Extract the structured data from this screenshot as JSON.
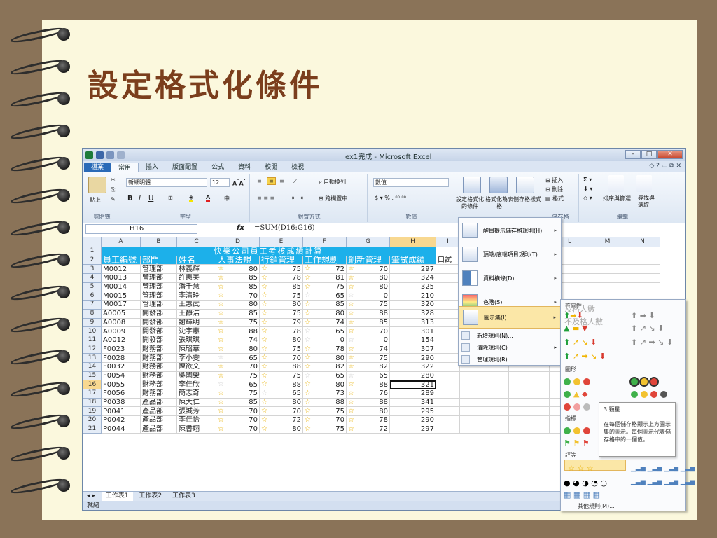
{
  "slide": {
    "title": "設定格式化條件"
  },
  "excel": {
    "window_title": "ex1完成 - Microsoft Excel",
    "tabs": [
      "檔案",
      "常用",
      "插入",
      "版面配置",
      "公式",
      "資料",
      "校閱",
      "檢視"
    ],
    "ribbon": {
      "clipboard": {
        "paste": "貼上",
        "label": "剪貼簿"
      },
      "font": {
        "name": "新細明體",
        "size": "12",
        "label": "字型"
      },
      "alignment": {
        "wrap": "自動換列",
        "merge": "跨欄置中",
        "label": "對齊方式"
      },
      "number": {
        "format": "數值",
        "label": "數值"
      },
      "styles": {
        "cond_format": "設定格式化的條件",
        "table_format": "格式化為表格",
        "cell_styles": "儲存格樣式"
      },
      "cells": {
        "insert": "插入",
        "delete": "刪除",
        "format": "格式",
        "label": "儲存格"
      },
      "editing": {
        "sort": "排序與篩選",
        "find": "尋找與選取",
        "label": "編輯"
      }
    },
    "namebox": "H16",
    "formula": "=SUM(D16:G16)",
    "columns": [
      "A",
      "B",
      "C",
      "D",
      "E",
      "F",
      "G",
      "H",
      "I",
      "J",
      "K",
      "L",
      "M",
      "N"
    ],
    "banner": "快樂公司員工考核成績計算",
    "headers": [
      "員工編號",
      "部門",
      "姓名",
      "人事法規",
      "行銷管理",
      "工作規劃",
      "創新管理",
      "筆試成績",
      "口試"
    ],
    "rows": [
      {
        "r": "3",
        "id": "M0012",
        "dept": "管理部",
        "name": "林義輝",
        "d": "80",
        "e": "75",
        "f": "72",
        "g": "70",
        "h": "297"
      },
      {
        "r": "4",
        "id": "M0013",
        "dept": "管理部",
        "name": "許惠美",
        "d": "85",
        "e": "78",
        "f": "81",
        "g": "80",
        "h": "324"
      },
      {
        "r": "5",
        "id": "M0014",
        "dept": "管理部",
        "name": "潘千慧",
        "d": "85",
        "e": "85",
        "f": "75",
        "g": "80",
        "h": "325"
      },
      {
        "r": "6",
        "id": "M0015",
        "dept": "管理部",
        "name": "李清玲",
        "d": "70",
        "e": "75",
        "f": "65",
        "g": "0",
        "h": "210"
      },
      {
        "r": "7",
        "id": "M0017",
        "dept": "管理部",
        "name": "王惠武",
        "d": "80",
        "e": "80",
        "f": "85",
        "g": "75",
        "h": "320"
      },
      {
        "r": "8",
        "id": "A0005",
        "dept": "開發部",
        "name": "王靜浩",
        "d": "85",
        "e": "75",
        "f": "80",
        "g": "88",
        "h": "328"
      },
      {
        "r": "9",
        "id": "A0008",
        "dept": "開發部",
        "name": "謝輝明",
        "d": "75",
        "e": "79",
        "f": "74",
        "g": "85",
        "h": "313"
      },
      {
        "r": "10",
        "id": "A0009",
        "dept": "開發部",
        "name": "沈宇惠",
        "d": "88",
        "e": "78",
        "f": "65",
        "g": "70",
        "h": "301"
      },
      {
        "r": "11",
        "id": "A0012",
        "dept": "開發部",
        "name": "張琪琪",
        "d": "74",
        "e": "80",
        "f": "0",
        "g": "0",
        "h": "154"
      },
      {
        "r": "12",
        "id": "F0023",
        "dept": "財務部",
        "name": "陳昭華",
        "d": "80",
        "e": "75",
        "f": "78",
        "g": "74",
        "h": "307"
      },
      {
        "r": "13",
        "id": "F0028",
        "dept": "財務部",
        "name": "李小雯",
        "d": "65",
        "e": "70",
        "f": "80",
        "g": "75",
        "h": "290"
      },
      {
        "r": "14",
        "id": "F0032",
        "dept": "財務部",
        "name": "陳欲文",
        "d": "70",
        "e": "88",
        "f": "82",
        "g": "82",
        "h": "322"
      },
      {
        "r": "15",
        "id": "F0054",
        "dept": "財務部",
        "name": "吳國榮",
        "d": "75",
        "e": "75",
        "f": "65",
        "g": "65",
        "h": "280"
      },
      {
        "r": "16",
        "id": "F0055",
        "dept": "財務部",
        "name": "李佳欣",
        "d": "65",
        "e": "88",
        "f": "80",
        "g": "88",
        "h": "321"
      },
      {
        "r": "17",
        "id": "F0056",
        "dept": "財務部",
        "name": "簡志奇",
        "d": "75",
        "e": "65",
        "f": "73",
        "g": "76",
        "h": "289"
      },
      {
        "r": "18",
        "id": "P0038",
        "dept": "產品部",
        "name": "陳大仁",
        "d": "85",
        "e": "80",
        "f": "88",
        "g": "88",
        "h": "341"
      },
      {
        "r": "19",
        "id": "P0041",
        "dept": "產品部",
        "name": "張誠芳",
        "d": "70",
        "e": "70",
        "f": "75",
        "g": "80",
        "h": "295"
      },
      {
        "r": "20",
        "id": "P0042",
        "dept": "產品部",
        "name": "李佳怡",
        "d": "70",
        "e": "72",
        "f": "70",
        "g": "78",
        "h": "290"
      },
      {
        "r": "21",
        "id": "P0044",
        "dept": "產品部",
        "name": "陳書翊",
        "d": "70",
        "e": "80",
        "f": "75",
        "g": "72",
        "h": "297"
      }
    ],
    "side_table": {
      "title": "人數統計表"
    },
    "sheet_tabs": [
      "工作表1",
      "工作表2",
      "工作表3"
    ],
    "status": "就緒",
    "cond_menu": {
      "items": [
        "醒目提示儲存格規則(H)",
        "頂端/底端項目規則(T)",
        "資料橫條(D)",
        "色階(S)",
        "圖示集(I)"
      ],
      "small_items": [
        "新增規則(N)...",
        "清除規則(C)",
        "管理規則(R)..."
      ]
    },
    "icon_sets": {
      "sections": [
        "方向性",
        "圖形",
        "指標",
        "評等"
      ],
      "ghost1": "及格人數",
      "ghost2": "不及格人數",
      "more": "其他規則(M)..."
    },
    "tooltip": {
      "title": "3 顆星",
      "body": "在每個儲存格顯示上方圖示集的圖示。每個圖示代表儲存格中的一個值。"
    }
  }
}
